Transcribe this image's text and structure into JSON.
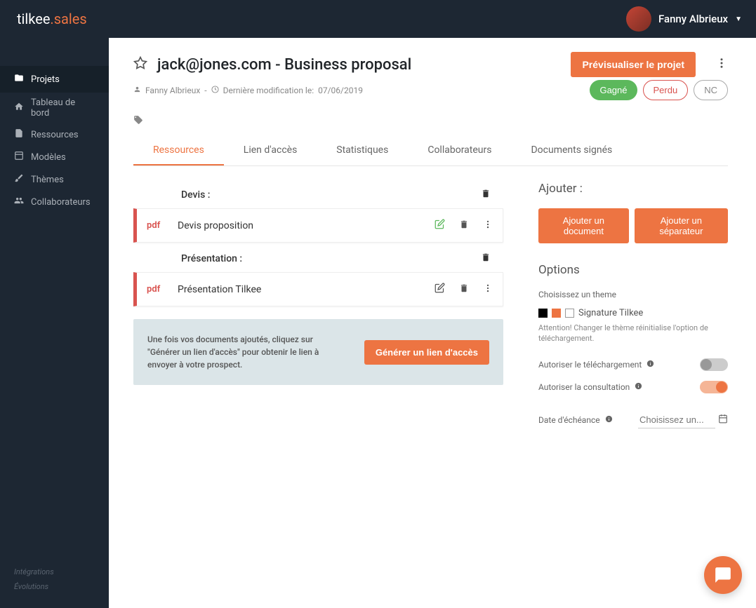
{
  "header": {
    "logo_main": "tilkee",
    "logo_sub": ".sales",
    "user_name": "Fanny Albrieux"
  },
  "sidebar": {
    "items": [
      {
        "label": "Projets"
      },
      {
        "label": "Tableau de bord"
      },
      {
        "label": "Ressources"
      },
      {
        "label": "Modèles"
      },
      {
        "label": "Thèmes"
      },
      {
        "label": "Collaborateurs"
      }
    ],
    "footer": [
      {
        "label": "Intégrations"
      },
      {
        "label": "Évolutions"
      }
    ]
  },
  "project": {
    "title": "jack@jones.com - Business proposal",
    "author": "Fanny Albrieux",
    "modified_prefix": "Dernière modification le:",
    "modified_date": "07/06/2019",
    "preview_btn": "Prévisualiser le projet",
    "status": {
      "won": "Gagné",
      "lost": "Perdu",
      "nc": "NC"
    }
  },
  "tabs": [
    {
      "label": "Ressources",
      "active": true
    },
    {
      "label": "Lien d'accès"
    },
    {
      "label": "Statistiques"
    },
    {
      "label": "Collaborateurs"
    },
    {
      "label": "Documents signés"
    }
  ],
  "sections": [
    {
      "title": "Devis :",
      "items": [
        {
          "type": "pdf",
          "name": "Devis proposition"
        }
      ]
    },
    {
      "title": "Présentation :",
      "items": [
        {
          "type": "pdf",
          "name": "Présentation Tilkee"
        }
      ]
    }
  ],
  "generate": {
    "text": "Une fois vos documents ajoutés, cliquez sur \"Générer un lien d'accès\" pour obtenir le lien à envoyer à votre prospect.",
    "btn": "Générer un lien d'accès"
  },
  "right": {
    "add_title": "Ajouter :",
    "add_doc": "Ajouter un document",
    "add_sep": "Ajouter un séparateur",
    "options_title": "Options",
    "theme_label": "Choisissez un theme",
    "theme_name": "Signature Tilkee",
    "theme_warning": "Attention! Changer le thème réinitialise l'option de téléchargement.",
    "allow_download": "Autoriser le téléchargement",
    "allow_view": "Autoriser la consultation",
    "due_date_label": "Date d'échéance",
    "due_date_placeholder": "Choisissez un..."
  }
}
